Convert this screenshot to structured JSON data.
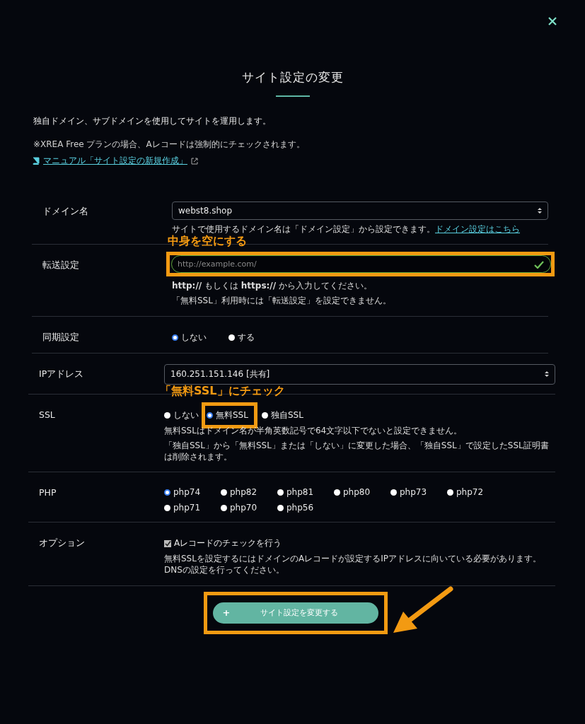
{
  "dialog": {
    "title": "サイト設定の変更",
    "intro": "独自ドメイン、サブドメインを使用してサイトを運用します。",
    "note": "※XREA Free プランの場合、Aレコードは強制的にチェックされます。",
    "manual_link": "マニュアル「サイト設定の新規作成」"
  },
  "groups": [
    {
      "rows": [
        {
          "kind": "select",
          "label": "ドメイン名",
          "value": "webst8.shop",
          "help": "サイトで使用するドメイン名は「ドメイン設定」から設定できます。",
          "help_link": "ドメイン設定はこちら"
        },
        {
          "kind": "text",
          "label": "転送設定",
          "placeholder": "http://example.com/",
          "valid": true,
          "highlight": true,
          "callout": "中身を空にする",
          "notes": [
            "**http://** もしくは **https://** から入力してください。",
            "「無料SSL」利用時には「転送設定」を設定できません。"
          ]
        },
        {
          "kind": "radio",
          "label": "同期設定",
          "options": [
            {
              "label": "しない",
              "selected": true,
              "highlight": false
            },
            {
              "label": "する",
              "selected": false,
              "highlight": false
            }
          ]
        }
      ]
    },
    {
      "rows": [
        {
          "kind": "select",
          "label": "IPアドレス",
          "value": "160.251.151.146 [共有]"
        },
        {
          "kind": "radio",
          "label": "SSL",
          "callout": "「無料SSL」にチェック",
          "options": [
            {
              "label": "しない",
              "selected": false,
              "highlight": false
            },
            {
              "label": "無料SSL",
              "selected": true,
              "highlight": true
            },
            {
              "label": "独自SSL",
              "selected": false,
              "highlight": false
            }
          ],
          "notes": [
            "無料SSLはドメイン名が半角英数記号で64文字以下でないと設定できません。",
            "「独自SSL」から「無料SSL」または「しない」に変更した場合、「独自SSL」で設定したSSL証明書は削除されます。"
          ]
        },
        {
          "kind": "radio",
          "label": "PHP",
          "options": [
            {
              "label": "php74",
              "selected": true,
              "highlight": false
            },
            {
              "label": "php82",
              "selected": false,
              "highlight": false
            },
            {
              "label": "php81",
              "selected": false,
              "highlight": false
            },
            {
              "label": "php80",
              "selected": false,
              "highlight": false
            },
            {
              "label": "php73",
              "selected": false,
              "highlight": false
            },
            {
              "label": "php72",
              "selected": false,
              "highlight": false
            },
            {
              "label": "php71",
              "selected": false,
              "highlight": false
            },
            {
              "label": "php70",
              "selected": false,
              "highlight": false
            },
            {
              "label": "php56",
              "selected": false,
              "highlight": false
            }
          ]
        },
        {
          "kind": "checkbox",
          "label": "オプション",
          "option": "Aレコードのチェックを行う",
          "checked": true,
          "notes": [
            "無料SSLを設定するにはドメインのAレコードが設定するIPアドレスに向いている必要があります。DNSの設定を行ってください。"
          ]
        }
      ]
    }
  ],
  "submit": {
    "icon": "+",
    "label": "サイト設定を変更する",
    "highlight": true
  }
}
